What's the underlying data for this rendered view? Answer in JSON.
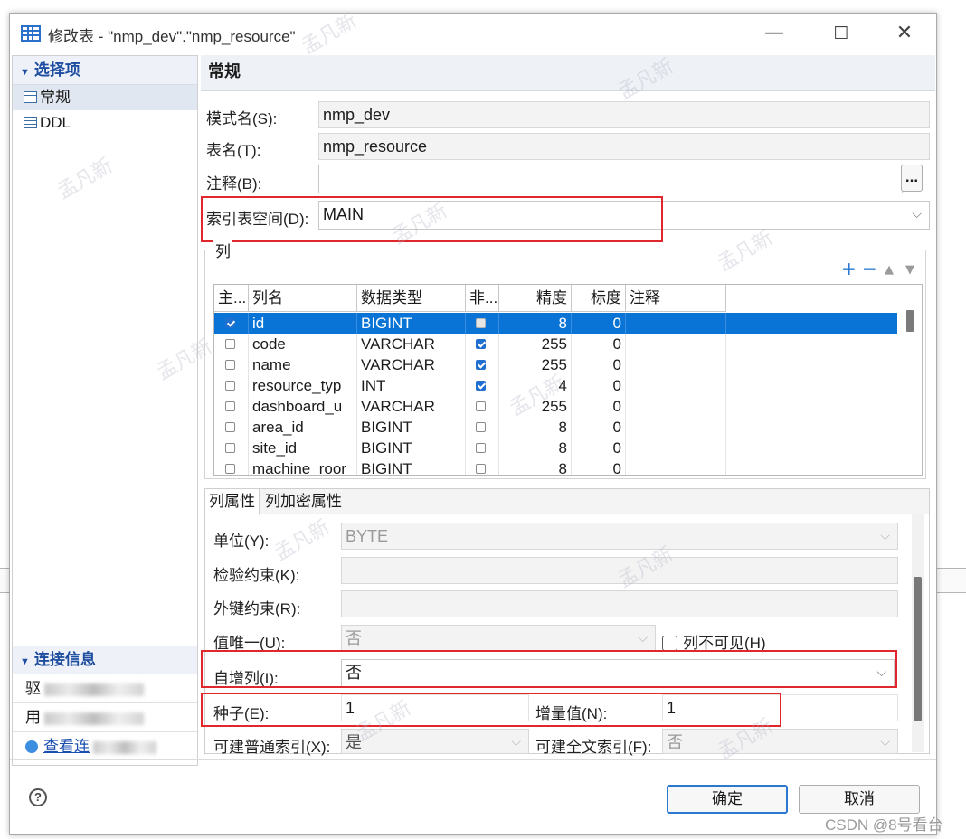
{
  "window": {
    "title": "修改表 - \"nmp_dev\".\"nmp_resource\""
  },
  "window_controls": {
    "minimize": "—",
    "maximize": "☐",
    "close": "✕"
  },
  "sidebar": {
    "section_title": "选择项",
    "items": [
      {
        "label": "常规",
        "selected": true
      },
      {
        "label": "DDL",
        "selected": false
      }
    ],
    "conn_title": "连接信息",
    "conn_rows": [
      {
        "label": "驱"
      },
      {
        "label": "用"
      }
    ],
    "conn_link": "查看连"
  },
  "general": {
    "header": "常规",
    "schema_label": "模式名(S):",
    "schema_value": "nmp_dev",
    "table_label": "表名(T):",
    "table_value": "nmp_resource",
    "comment_label": "注释(B):",
    "comment_value": "",
    "comment_btn": "...",
    "index_ts_label": "索引表空间(D):",
    "index_ts_value": "MAIN"
  },
  "columns": {
    "group_title": "列",
    "toolbar": {
      "add": "+",
      "remove": "−",
      "up": "▲",
      "down": "▼"
    },
    "headers": [
      "主...",
      "列名",
      "数据类型",
      "非...",
      "精度",
      "标度",
      "注释"
    ],
    "rows": [
      {
        "pk": true,
        "name": "id",
        "type": "BIGINT",
        "not_null": false,
        "precision": "8",
        "scale": "0",
        "comment": "",
        "selected": true
      },
      {
        "pk": false,
        "name": "code",
        "type": "VARCHAR",
        "not_null": true,
        "precision": "255",
        "scale": "0",
        "comment": ""
      },
      {
        "pk": false,
        "name": "name",
        "type": "VARCHAR",
        "not_null": true,
        "precision": "255",
        "scale": "0",
        "comment": ""
      },
      {
        "pk": false,
        "name": "resource_typ",
        "type": "INT",
        "not_null": true,
        "precision": "4",
        "scale": "0",
        "comment": ""
      },
      {
        "pk": false,
        "name": "dashboard_u",
        "type": "VARCHAR",
        "not_null": false,
        "precision": "255",
        "scale": "0",
        "comment": ""
      },
      {
        "pk": false,
        "name": "area_id",
        "type": "BIGINT",
        "not_null": false,
        "precision": "8",
        "scale": "0",
        "comment": ""
      },
      {
        "pk": false,
        "name": "site_id",
        "type": "BIGINT",
        "not_null": false,
        "precision": "8",
        "scale": "0",
        "comment": ""
      },
      {
        "pk": false,
        "name": "machine_roor",
        "type": "BIGINT",
        "not_null": false,
        "precision": "8",
        "scale": "0",
        "comment": ""
      }
    ]
  },
  "tabs": [
    {
      "label": "列属性",
      "active": true
    },
    {
      "label": "列加密属性",
      "active": false
    }
  ],
  "props": {
    "unit_label": "单位(Y):",
    "unit_value": "BYTE",
    "check_label": "检验约束(K):",
    "check_value": "",
    "fk_label": "外键约束(R):",
    "fk_value": "",
    "unique_label": "值唯一(U):",
    "unique_value": "否",
    "invisible_label": "列不可见(H)",
    "identity_label": "自增列(I):",
    "identity_value": "否",
    "seed_label": "种子(E):",
    "seed_value": "1",
    "increment_label": "增量值(N):",
    "increment_value": "1",
    "normal_index_label": "可建普通索引(X):",
    "normal_index_value": "是",
    "fulltext_label": "可建全文索引(F):",
    "fulltext_value": "否"
  },
  "footer": {
    "help": "?",
    "ok": "确定",
    "cancel": "取消"
  },
  "watermark": {
    "text": "孟凡新",
    "credit": "CSDN @8号看台"
  },
  "colors": {
    "accent": "#0a74d6",
    "highlight": "#e0272b",
    "section_title": "#1f4ea0"
  }
}
